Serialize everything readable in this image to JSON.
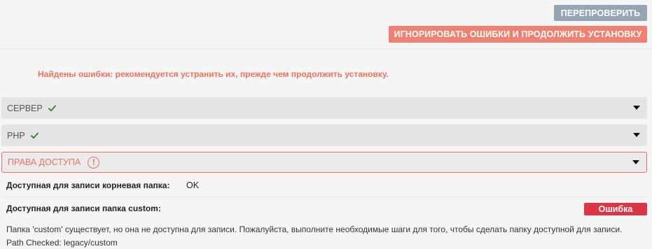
{
  "actions": {
    "recheck_label": "ПЕРЕПРОВЕРИТЬ",
    "ignore_label": "ИГНОРИРОВАТЬ ОШИБКИ И ПРОДОЛЖИТЬ УСТАНОВКУ"
  },
  "warning": "Найдены ошибки: рекомендуется устранить их, прежде чем продолжить установку.",
  "sections": {
    "server": {
      "label": "СЕРВЕР",
      "status": "ok"
    },
    "php": {
      "label": "PHP",
      "status": "ok"
    },
    "permissions": {
      "label": "ПРАВА ДОСТУПА",
      "status": "error",
      "alert_symbol": "!"
    }
  },
  "checks": {
    "root": {
      "label": "Доступная для записи корневая папка:",
      "value": "OK"
    },
    "custom": {
      "label": "Доступная для записи папка custom:",
      "badge": "Ошибка",
      "message": "Папка 'custom' существует, но она не доступна для записи. Пожалуйста, выполните необходимые шаги для того, чтобы сделать папку доступной для записи.",
      "path": "Path Checked: legacy/custom"
    }
  },
  "colors": {
    "recheck_button": "#95a5b3",
    "ignore_button": "#ef8173",
    "warning_text": "#ea7262",
    "ok_check": "#2e7d32",
    "error_badge": "#dc3545",
    "section_bg": "#e4e4e4"
  },
  "icons": {
    "ok": "check-icon",
    "expand": "caret-down-icon",
    "alert": "alert-circle-icon"
  }
}
